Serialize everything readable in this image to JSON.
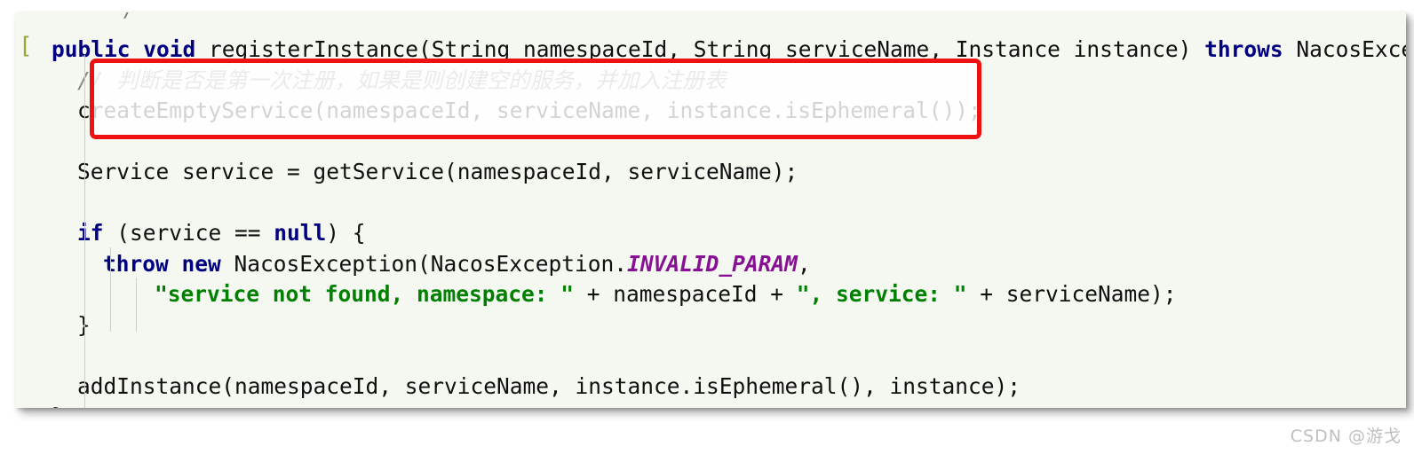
{
  "window": {
    "background_color": "#ffffff",
    "editor_background": "#f4f8f1"
  },
  "editor": {
    "fold_marker": "[",
    "truncated_fragment_above": "/",
    "language": "Java",
    "syntax_colors": {
      "keyword": "#000080",
      "string": "#008000",
      "comment": "#8a8a8a",
      "constant": "#871094",
      "plain": "#101010"
    },
    "lines": [
      {
        "n": 1,
        "indent": 0,
        "tokens": [
          {
            "t": "kw",
            "s": "public"
          },
          {
            "t": "plain",
            "s": " "
          },
          {
            "t": "kw",
            "s": "void"
          },
          {
            "t": "plain",
            "s": " registerInstance(String namespaceId, String serviceName, Instance instance) "
          },
          {
            "t": "kw",
            "s": "throws"
          },
          {
            "t": "plain",
            "s": " NacosException"
          }
        ]
      },
      {
        "n": 2,
        "indent": 1,
        "tokens": [
          {
            "t": "cmtmark",
            "s": "// "
          },
          {
            "t": "cmt",
            "s": "判断是否是第一次注册，如果是则创建空的服务，并加入注册表"
          }
        ]
      },
      {
        "n": 3,
        "indent": 1,
        "tokens": [
          {
            "t": "plain",
            "s": "createEmptyService(namespaceId, serviceName, instance.isEphemeral());"
          }
        ]
      },
      {
        "n": 4,
        "indent": 0,
        "tokens": []
      },
      {
        "n": 5,
        "indent": 1,
        "tokens": [
          {
            "t": "plain",
            "s": "Service service = getService(namespaceId, serviceName);"
          }
        ]
      },
      {
        "n": 6,
        "indent": 0,
        "tokens": []
      },
      {
        "n": 7,
        "indent": 1,
        "tokens": [
          {
            "t": "kw",
            "s": "if"
          },
          {
            "t": "plain",
            "s": " (service == "
          },
          {
            "t": "kw",
            "s": "null"
          },
          {
            "t": "plain",
            "s": ") {"
          }
        ]
      },
      {
        "n": 8,
        "indent": 2,
        "tokens": [
          {
            "t": "kw",
            "s": "throw"
          },
          {
            "t": "plain",
            "s": " "
          },
          {
            "t": "kw",
            "s": "new"
          },
          {
            "t": "plain",
            "s": " NacosException(NacosException."
          },
          {
            "t": "const",
            "s": "INVALID_PARAM"
          },
          {
            "t": "plain",
            "s": ","
          }
        ]
      },
      {
        "n": 9,
        "indent": 4,
        "tokens": [
          {
            "t": "str",
            "s": "\"service not found, namespace: \""
          },
          {
            "t": "plain",
            "s": " + namespaceId + "
          },
          {
            "t": "str",
            "s": "\", service: \""
          },
          {
            "t": "plain",
            "s": " + serviceName);"
          }
        ]
      },
      {
        "n": 10,
        "indent": 1,
        "tokens": [
          {
            "t": "plain",
            "s": "}"
          }
        ]
      },
      {
        "n": 11,
        "indent": 0,
        "tokens": []
      },
      {
        "n": 12,
        "indent": 1,
        "tokens": [
          {
            "t": "plain",
            "s": "addInstance(namespaceId, serviceName, instance.isEphemeral(), instance);"
          }
        ]
      },
      {
        "n": 13,
        "indent": 0,
        "tokens": [
          {
            "t": "plain",
            "s": "}"
          }
        ]
      }
    ]
  },
  "annotation": {
    "type": "red-rectangle-highlight",
    "color": "#ee1111",
    "highlighted_lines": [
      2,
      3
    ]
  },
  "watermark": {
    "text": "CSDN @游戈"
  }
}
